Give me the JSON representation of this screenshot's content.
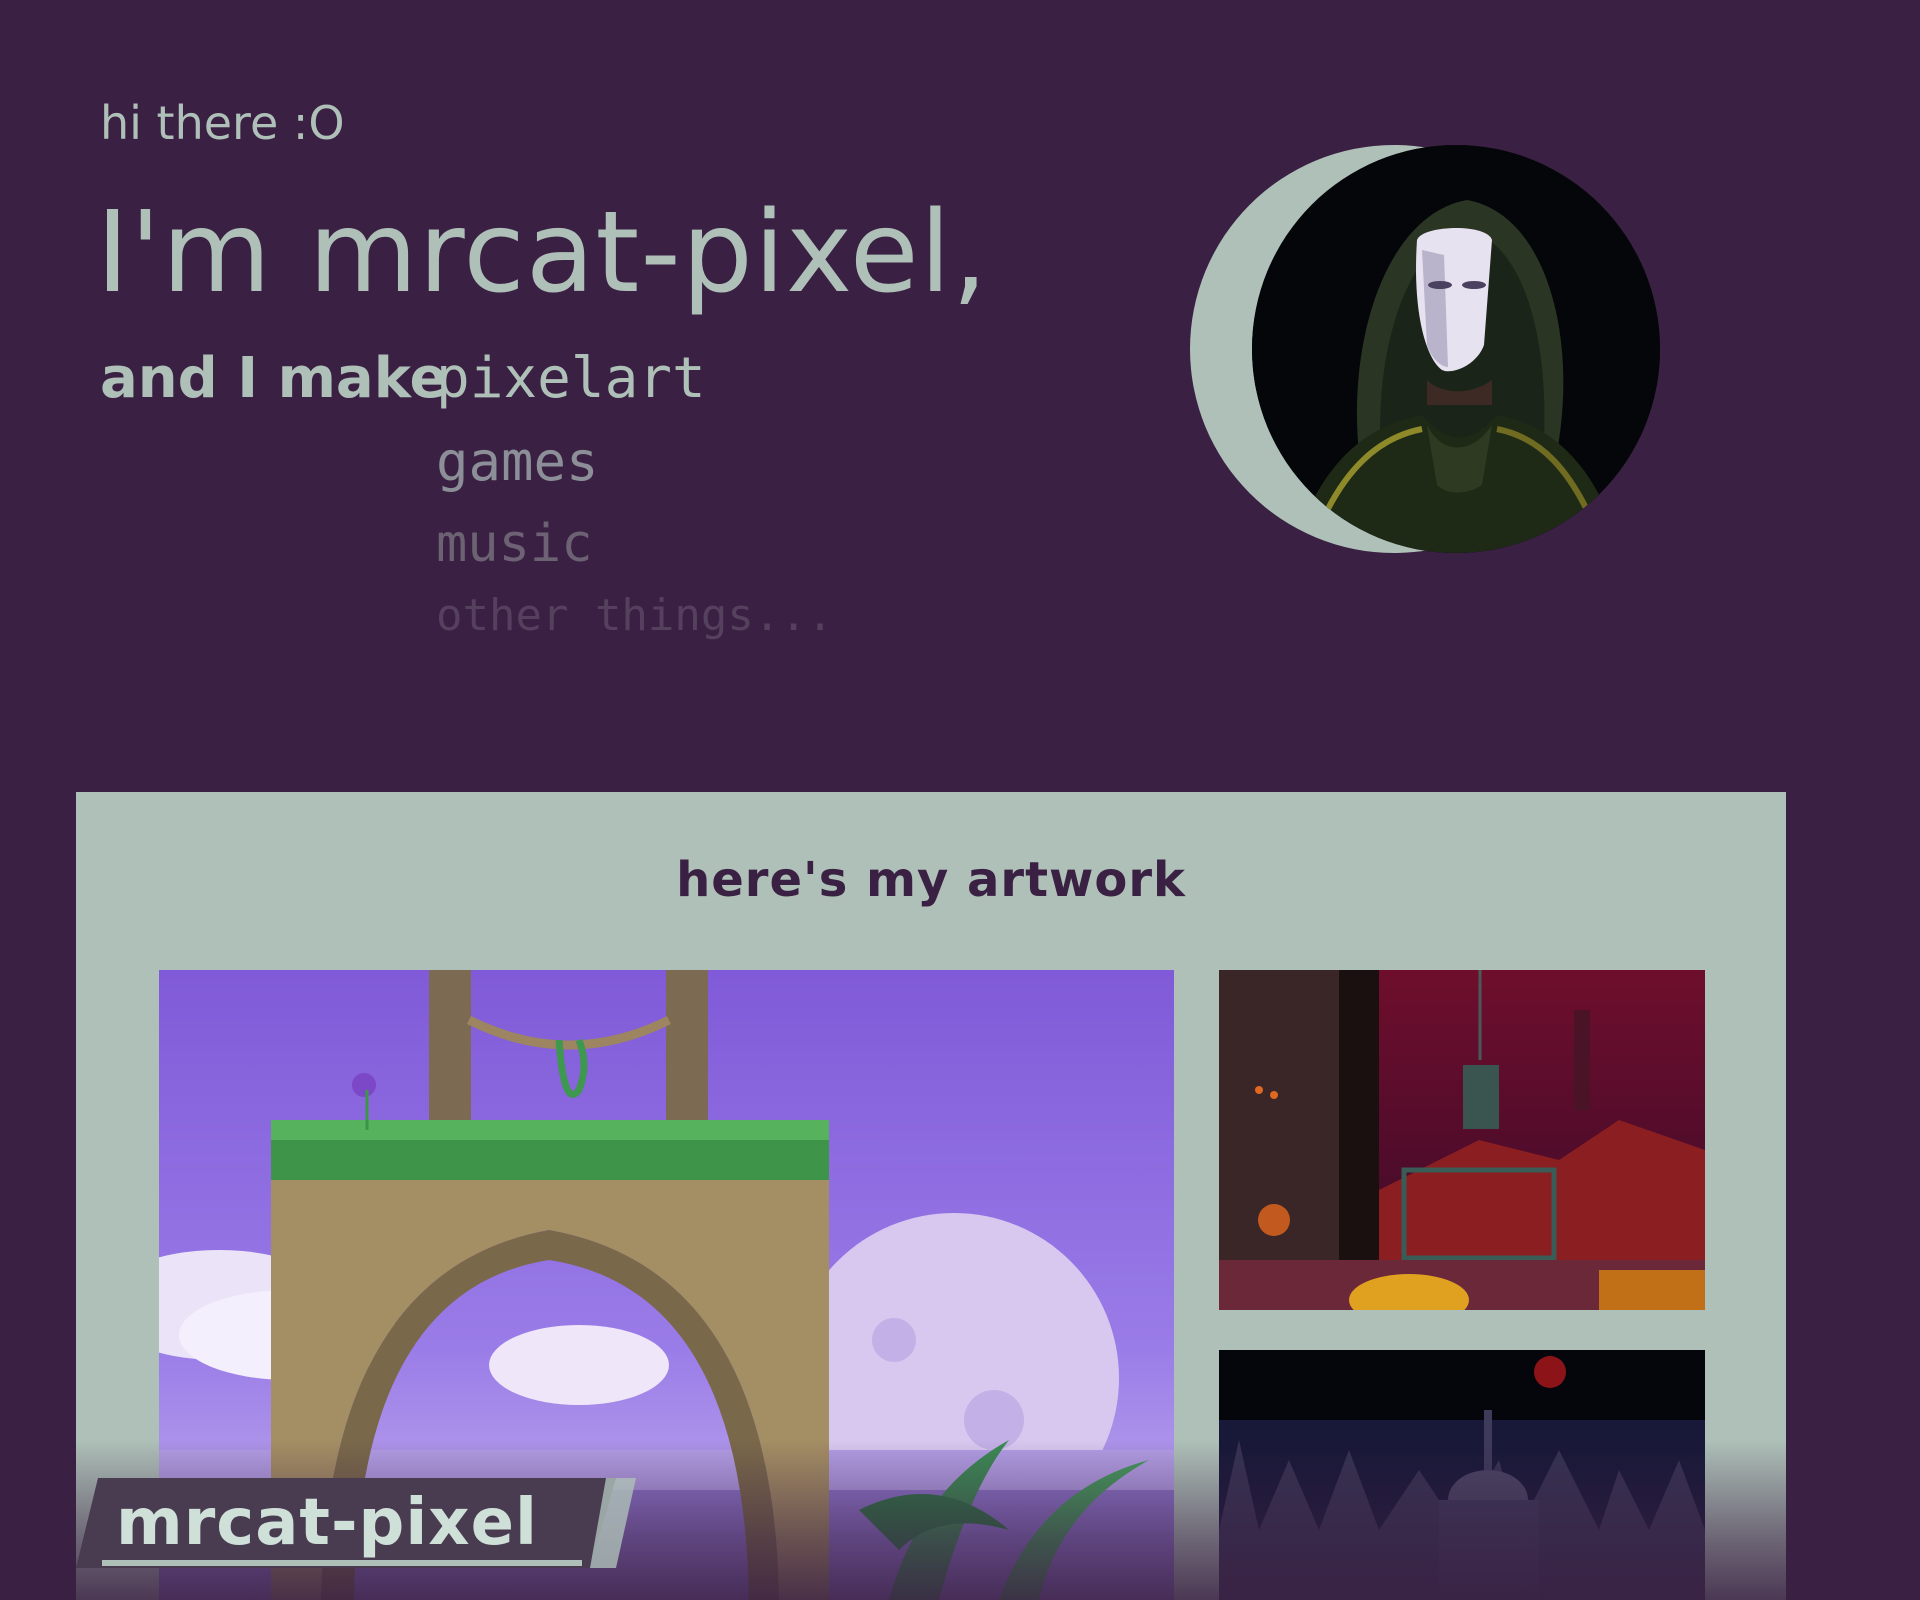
{
  "hero": {
    "greeting": "hi there :O",
    "name": "I'm mrcat-pixel,",
    "make_label": "and I make",
    "make_items": [
      "pixelart",
      "games",
      "music",
      "other things..."
    ]
  },
  "avatar": {
    "alt": "hooded masked figure pixel portrait"
  },
  "artwork": {
    "title": "here's my artwork",
    "items": [
      {
        "name": "stone-arch-sky-scene"
      },
      {
        "name": "red-castle-interior-scene"
      },
      {
        "name": "dark-night-castle-scene"
      }
    ]
  },
  "logo": {
    "text": "mrcat-pixel"
  },
  "colors": {
    "background": "#3a2042",
    "accent": "#aec0b8",
    "panel": "#aec0b8",
    "title_text": "#3a2042"
  }
}
